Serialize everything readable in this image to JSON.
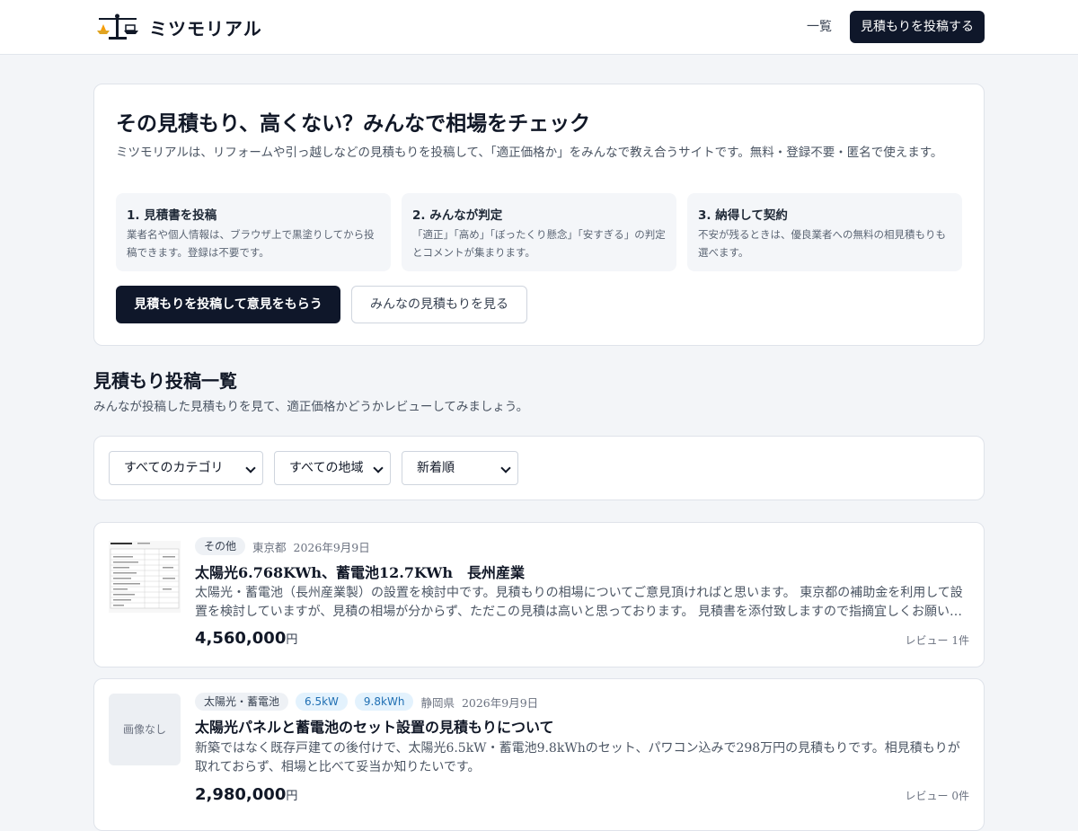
{
  "header": {
    "site_name": "ミツモリアル",
    "nav_list": "一覧",
    "post_button": "見積もりを投稿する"
  },
  "hero": {
    "title": "その見積もり、高くない？みんなで相場をチェック",
    "description": "ミツモリアルは、リフォームや引っ越しなどの見積もりを投稿して、「適正価格か」をみんなで教え合うサイトです。無料・登録不要・匿名で使えます。",
    "steps": [
      {
        "title": "1. 見積書を投稿",
        "desc": "業者名や個人情報は、ブラウザ上で黒塗りしてから投稿できます。登録は不要です。"
      },
      {
        "title": "2. みんなが判定",
        "desc": "「適正」「高め」「ぼったくり懸念」「安すぎる」の判定とコメントが集まります。"
      },
      {
        "title": "3. 納得して契約",
        "desc": "不安が残るときは、優良業者への無料の相見積もりも選べます。"
      }
    ],
    "primary_button": "見積もりを投稿して意見をもらう",
    "secondary_button": "みんなの見積もりを見る"
  },
  "list_section": {
    "title": "見積もり投稿一覧",
    "description": "みんなが投稿した見積もりを見て、適正価格かどうかレビューしてみましょう。"
  },
  "filters": {
    "category": "すべてのカテゴリ",
    "region": "すべての地域",
    "sort": "新着順"
  },
  "listings": [
    {
      "category": "その他",
      "region": "東京都",
      "date": "2026年9月9日",
      "title": "太陽光6.768KWh、蓄電池12.7KWh　長州産業",
      "body": "太陽光・蓄電池（長州産業製）の設置を検討中です。見積もりの相場についてご意見頂ければと思います。 東京都の補助金を利用して設置を検討していますが、見積の相場が分からず、ただこの見積は高いと思っております。 見積書を添付致しますので指摘宜しくお願い…",
      "price": "4,560,000",
      "unit": "円",
      "reviews": "レビュー 1件"
    },
    {
      "category": "太陽光・蓄電池",
      "tags": [
        "6.5kW",
        "9.8kWh"
      ],
      "region": "静岡県",
      "date": "2026年9月9日",
      "thumb_text": "画像なし",
      "title": "太陽光パネルと蓄電池のセット設置の見積もりについて",
      "body": "新築ではなく既存戸建ての後付けで、太陽光6.5kW・蓄電池9.8kWhのセット、パワコン込みで298万円の見積もりです。相見積もりが取れておらず、相場と比べて妥当か知りたいです。",
      "price": "2,980,000",
      "unit": "円",
      "reviews": "レビュー 0件"
    }
  ]
}
